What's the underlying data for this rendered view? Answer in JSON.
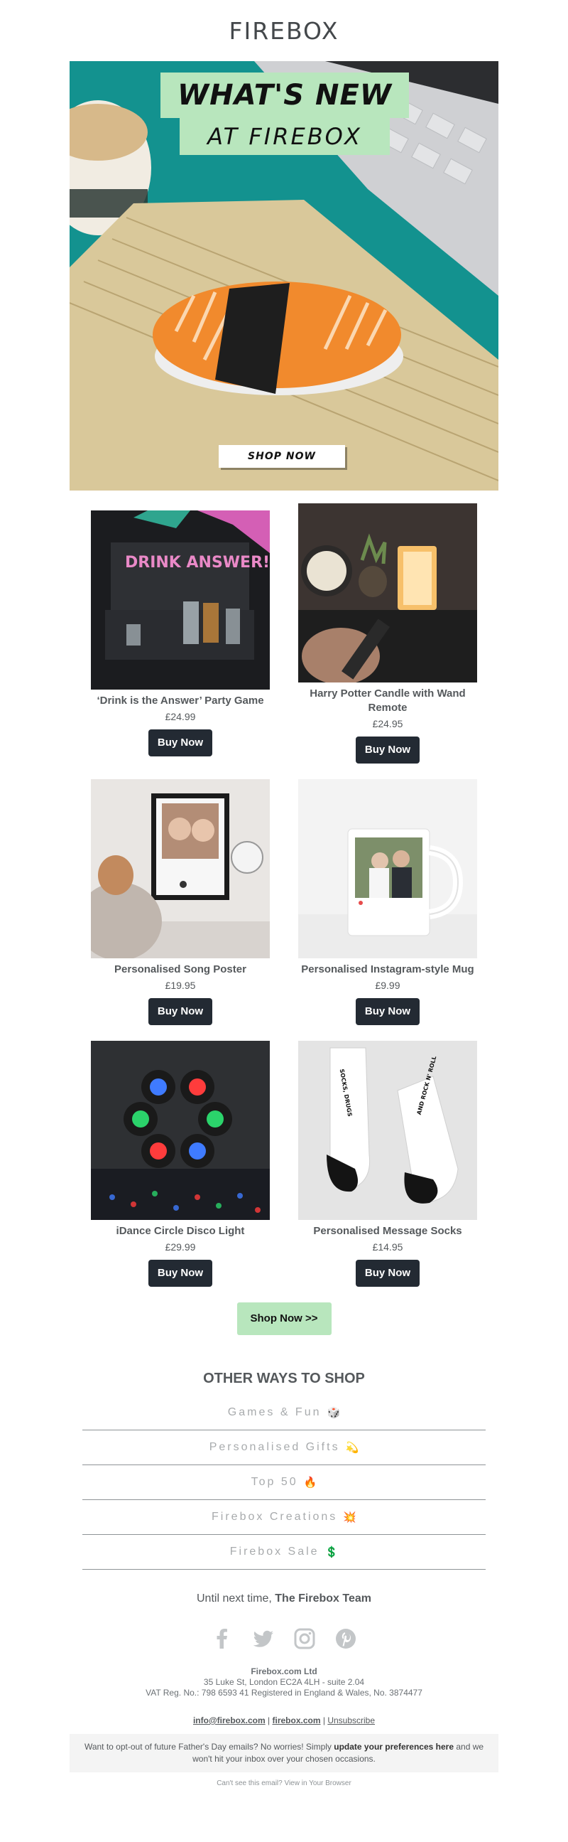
{
  "brand": {
    "logo": "FIREBOX"
  },
  "hero": {
    "title_line1": "WHAT'S NEW",
    "title_line2": "AT FIREBOX",
    "cta": "SHOP NOW",
    "colors": {
      "teal": "#13928f",
      "green": "#b8e6bd"
    }
  },
  "products": [
    {
      "name": "‘Drink is the Answer’ Party Game",
      "price": "£24.99",
      "cta": "Buy Now",
      "image_text": "DRINK ANSWER!"
    },
    {
      "name": "Harry Potter Candle with Wand Remote",
      "price": "£24.95",
      "cta": "Buy Now"
    },
    {
      "name": "Personalised Song Poster",
      "price": "£19.95",
      "cta": "Buy Now"
    },
    {
      "name": "Personalised Instagram-style Mug",
      "price": "£9.99",
      "cta": "Buy Now"
    },
    {
      "name": "iDance Circle Disco Light",
      "price": "£29.99",
      "cta": "Buy Now"
    },
    {
      "name": "Personalised Message Socks",
      "price": "£14.95",
      "cta": "Buy Now",
      "image_text_1": "SOCKS, DRUGS",
      "image_text_2": "AND ROCK N' ROLL"
    }
  ],
  "shop_now": "Shop Now >>",
  "other_ways": {
    "title": "OTHER WAYS TO SHOP",
    "items": [
      {
        "label": "Games & Fun",
        "emoji": "🎲"
      },
      {
        "label": "Personalised Gifts",
        "emoji": "💫"
      },
      {
        "label": "Top 50",
        "emoji": "🔥"
      },
      {
        "label": "Firebox Creations",
        "emoji": "💥"
      },
      {
        "label": "Firebox Sale",
        "emoji": "💲"
      }
    ]
  },
  "signoff": {
    "prefix": "Until next time,",
    "team": "The Firebox Team"
  },
  "social": [
    "facebook-icon",
    "twitter-icon",
    "instagram-icon",
    "pinterest-icon"
  ],
  "company": {
    "name": "Firebox.com Ltd",
    "address": "35 Luke St, London EC2A 4LH - suite 2.04",
    "vat": "VAT Reg. No.: 798 6593 41 Registered in England & Wales, No. 3874477"
  },
  "links": {
    "email": "info@firebox.com",
    "site": "firebox.com",
    "unsubscribe": "Unsubscribe",
    "sep": "|"
  },
  "optout": {
    "pre": "Want to opt-out of future Father's Day emails? No worries! Simply",
    "bold": "update your preferences here",
    "post": "and we won't hit your inbox over your chosen occasions."
  },
  "view_browser": "Can't see this email? View in Your Browser"
}
